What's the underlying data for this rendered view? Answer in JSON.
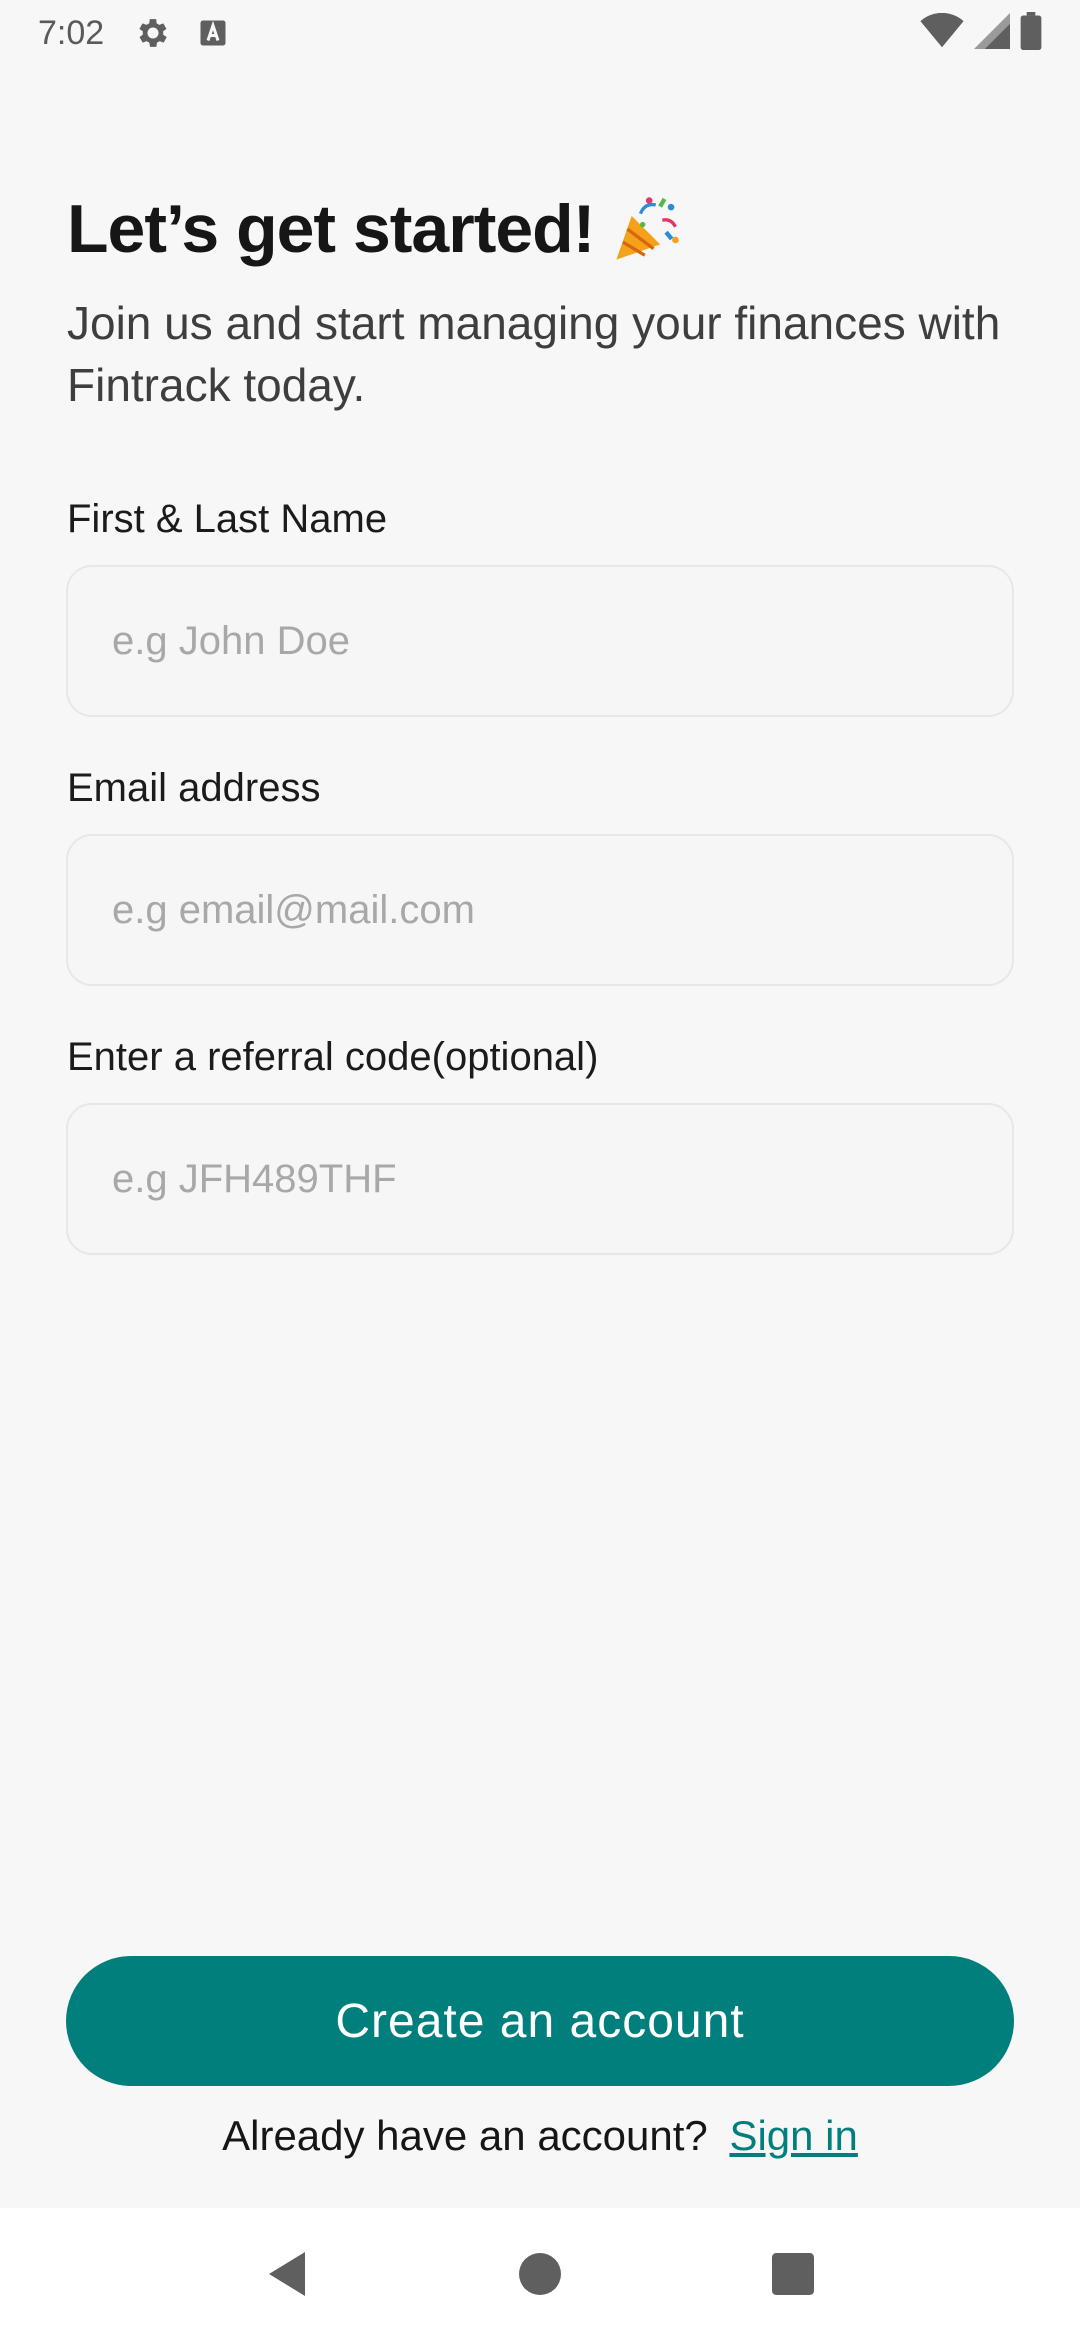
{
  "status_bar": {
    "time": "7:02",
    "left_icons": [
      "gear-icon",
      "keyboard-a-icon"
    ],
    "right_icons": [
      "wifi-icon",
      "signal-icon",
      "battery-icon"
    ]
  },
  "header": {
    "title": "Let’s get started!",
    "title_icon": "party-popper-icon",
    "subtitle": "Join us and start managing your finances with Fintrack today."
  },
  "form": {
    "name": {
      "label": "First & Last Name",
      "placeholder": "e.g John Doe",
      "value": ""
    },
    "email": {
      "label": "Email address",
      "placeholder": "e.g email@mail.com",
      "value": ""
    },
    "referral": {
      "label": "Enter a referral code(optional)",
      "placeholder": "e.g JFH489THF",
      "value": ""
    }
  },
  "actions": {
    "create_label": "Create an account",
    "signin_prompt": "Already have an account?",
    "signin_link": "Sign in"
  },
  "nav": {
    "icons": [
      "back-icon",
      "home-icon",
      "recents-icon"
    ]
  },
  "colors": {
    "accent": "#017f7d",
    "background": "#f7f7f7",
    "input_border": "#e7e7e7",
    "placeholder": "#a8a8a8"
  }
}
